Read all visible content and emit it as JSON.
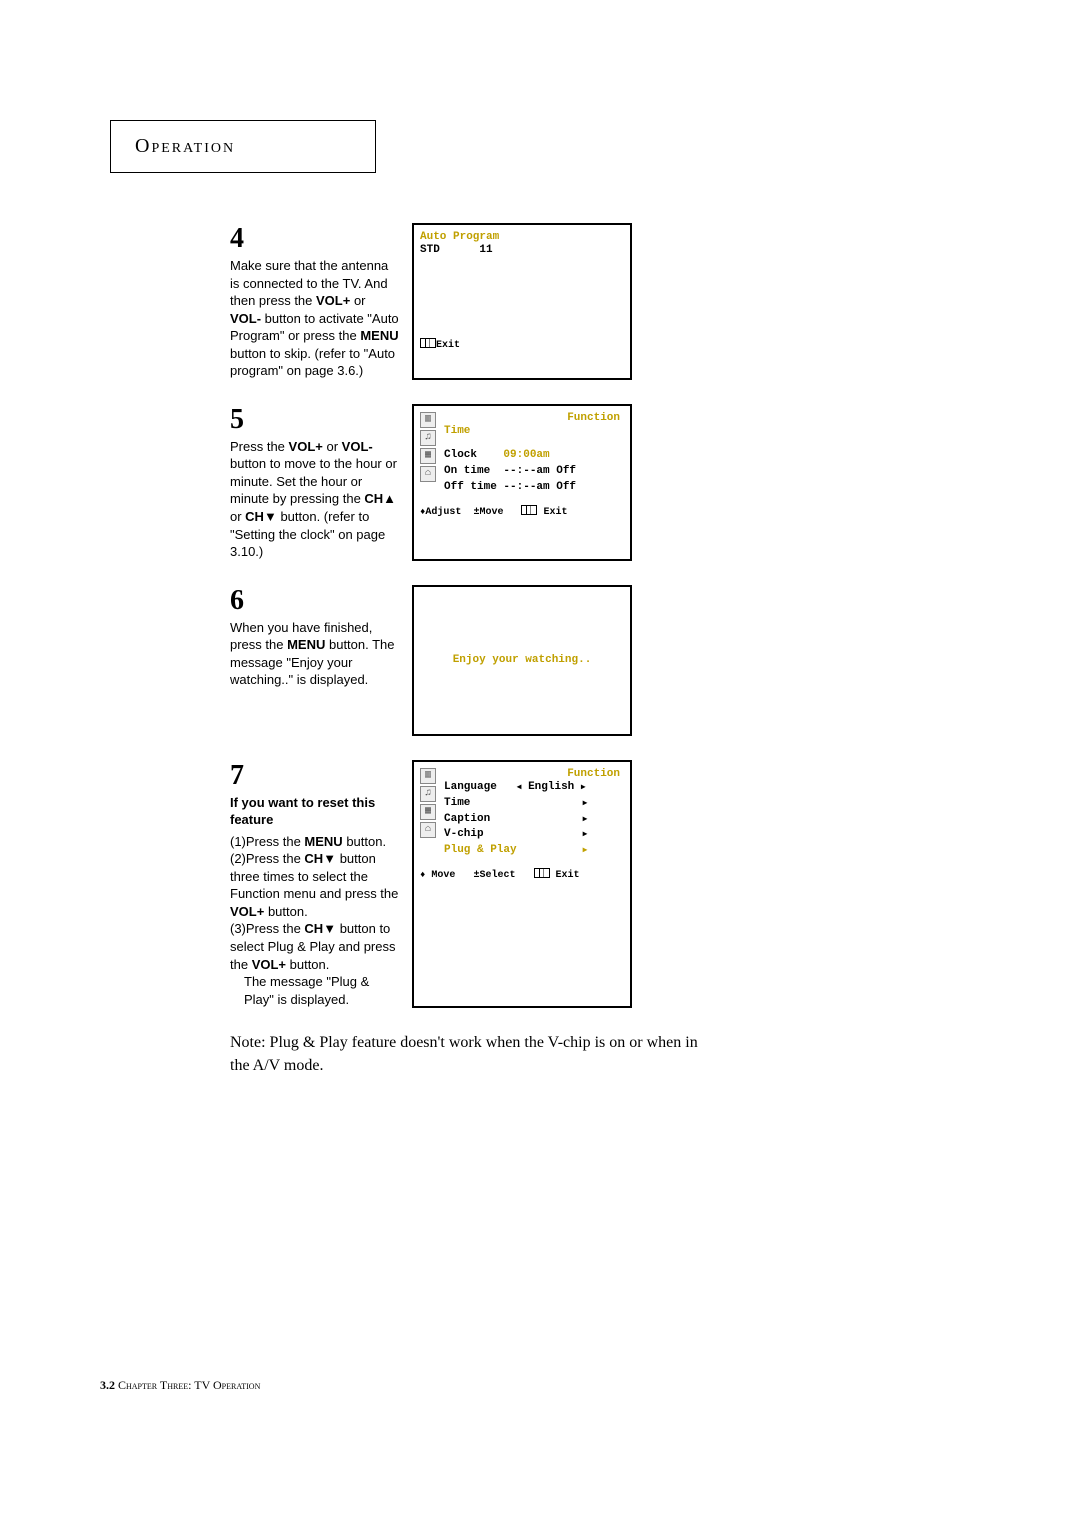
{
  "header": "Operation",
  "steps": {
    "s4": {
      "num": "4",
      "text_parts": {
        "a": "Make sure that the antenna is connected to the TV. And then press the ",
        "b": "VOL+",
        "c": " or ",
        "d": "VOL-",
        "e": " button to activate \"Auto Program\" or press the ",
        "f": "MENU",
        "g": " button to skip. (refer to \"Auto program\" on page 3.6.)"
      },
      "osd": {
        "title": "Auto Program",
        "line2_a": "STD",
        "line2_b": "11",
        "exit": "Exit"
      }
    },
    "s5": {
      "num": "5",
      "text_parts": {
        "a": "Press the ",
        "b": "VOL+",
        "c": " or ",
        "d": "VOL-",
        "e": " button to move to the hour or minute.  Set the hour or minute by pressing the ",
        "f": "CH▲",
        "g": " or ",
        "h": "CH▼",
        "i": " button. (refer to \"Setting the clock\" on page 3.10.)"
      },
      "osd": {
        "heading": "Function",
        "items": {
          "time": "Time",
          "clock_label": "Clock",
          "clock_value": "09:00am",
          "on_label": "On time",
          "on_value": "--:--am Off",
          "off_label": "Off time",
          "off_value": "--:--am Off"
        },
        "footer_adjust": "Adjust",
        "footer_move": "Move",
        "footer_exit": "Exit"
      }
    },
    "s6": {
      "num": "6",
      "text_parts": {
        "a": "When you have finished, press the ",
        "b": "MENU",
        "c": " button. The message \"Enjoy your watching..\" is displayed."
      },
      "osd": {
        "message": "Enjoy your watching.."
      }
    },
    "s7": {
      "num": "7",
      "subhead": "If you want to reset this feature",
      "text_parts": {
        "p1a": "(1)Press the ",
        "p1b": "MENU",
        "p1c": " button.",
        "p2a": "(2)Press the ",
        "p2b": "CH▼",
        "p2c": " button three times to select the Function menu and press the ",
        "p2d": "VOL+",
        "p2e": " button.",
        "p3a": "(3)Press the ",
        "p3b": "CH▼",
        "p3c": " button to select Plug & Play and press the ",
        "p3d": "VOL+",
        "p3e": " button.",
        "p4": "The message \"Plug & Play\" is displayed."
      },
      "osd": {
        "heading": "Function",
        "items": {
          "lang_label": "Language",
          "lang_value": "English",
          "time": "Time",
          "caption": "Caption",
          "vchip": "V-chip",
          "plug": "Plug & Play"
        },
        "footer_move": "Move",
        "footer_select": "Select",
        "footer_exit": "Exit"
      }
    }
  },
  "note": "Note: Plug & Play feature doesn't work when the V-chip is on or when in the A/V mode.",
  "page_footer": {
    "page": "3.2",
    "chapter": " Chapter Three:  TV Operation"
  }
}
